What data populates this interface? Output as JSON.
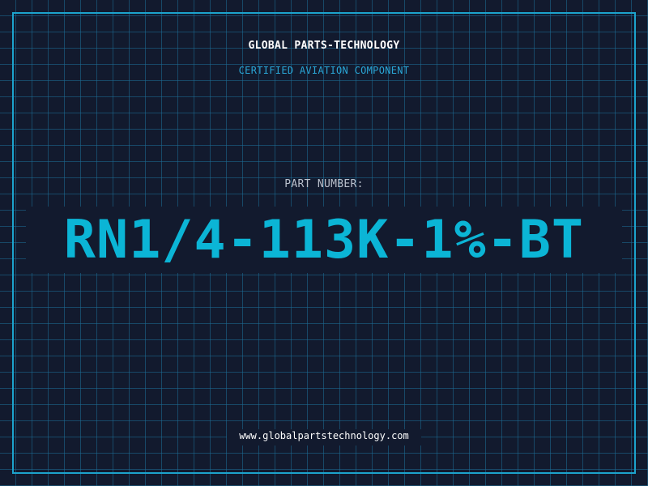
{
  "header": {
    "company": "GLOBAL PARTS-TECHNOLOGY",
    "subtitle": "CERTIFIED AVIATION COMPONENT"
  },
  "part": {
    "label": "PART NUMBER:",
    "number": "RN1/4-113K-1%-BT"
  },
  "footer": {
    "website": "www.globalpartstechnology.com"
  },
  "colors": {
    "background": "#121a2e",
    "grid": "#1c6e96",
    "frame": "#1ca3cc",
    "accent": "#0bb5d6"
  }
}
